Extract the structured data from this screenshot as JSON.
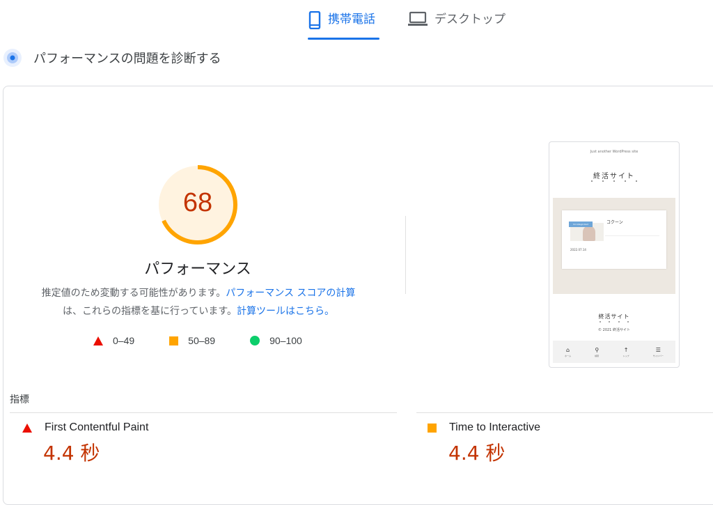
{
  "tabs": [
    {
      "label": "携帯電話",
      "icon": "smartphone-icon",
      "active": true
    },
    {
      "label": "デスクトップ",
      "icon": "laptop-icon",
      "active": false
    }
  ],
  "diagnose": {
    "label": "パフォーマンスの問題を診断する"
  },
  "score": {
    "value": "68",
    "category": "パフォーマンス",
    "fraction": 0.68
  },
  "description": {
    "text1": "推定値のため変動する可能性があります。",
    "link1": "パフォーマンス スコアの計算",
    "text2": "は、これらの指標を基に行っています。",
    "link2": "計算ツールはこちら。"
  },
  "legend": [
    {
      "range": "0–49",
      "shape": "red-triangle"
    },
    {
      "range": "50–89",
      "shape": "orange-square"
    },
    {
      "range": "90–100",
      "shape": "green-circle"
    }
  ],
  "screenshot": {
    "tagline": "Just another WordPress site",
    "site_title": "終活サイト",
    "post_title": "コクーン",
    "badge": "Uncategorized",
    "date": "2022.07.14",
    "footer_title": "終活サイト",
    "copyright": "© 2021 終活サイト",
    "nav": [
      {
        "label": "ホーム",
        "icon": "home-icon"
      },
      {
        "label": "検索",
        "icon": "search-icon"
      },
      {
        "label": "トップ",
        "icon": "arrow-up-icon"
      },
      {
        "label": "サイドバー",
        "icon": "sidebar-icon"
      }
    ]
  },
  "metrics": {
    "label": "指標",
    "items": [
      {
        "name": "First Contentful Paint",
        "value": "4.4 秒",
        "status": "red-triangle"
      },
      {
        "name": "Time to Interactive",
        "value": "4.4 秒",
        "status": "orange-square"
      }
    ]
  },
  "colors": {
    "accent": "#1a73e8",
    "fail": "#eb0f00",
    "average": "#ffa400",
    "pass": "#0cce6b",
    "score_text": "#c33300"
  }
}
